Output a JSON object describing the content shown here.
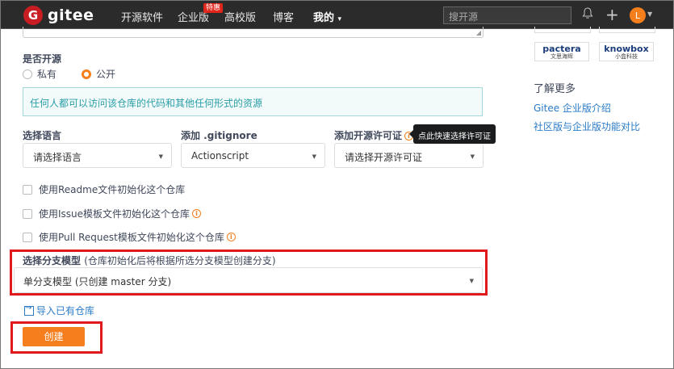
{
  "nav": {
    "brand": "gitee",
    "brand_initial": "G",
    "items": [
      "开源软件",
      "企业版",
      "高校版",
      "博客"
    ],
    "hot_badge": "特惠",
    "my": "我的",
    "my_caret": "▾",
    "search_placeholder": "搜开源",
    "avatar_initial": "L",
    "plus": "+",
    "bell": "🔔"
  },
  "form": {
    "open_source_label": "是否开源",
    "private_label": "私有",
    "public_label": "公开",
    "public_info": "任何人都可以访问该仓库的代码和其他任何形式的资源",
    "language_label": "选择语言",
    "language_value": "请选择语言",
    "gitignore_label": "添加 .gitignore",
    "gitignore_value": "Actionscript",
    "license_label": "添加开源许可证",
    "license_value": "请选择开源许可证",
    "license_tooltip": "点此快速选择许可证",
    "checks": [
      "使用Readme文件初始化这个仓库",
      "使用Issue模板文件初始化这个仓库",
      "使用Pull Request模板文件初始化这个仓库"
    ],
    "branch_label": "选择分支模型",
    "branch_hint": "(仓库初始化后将根据所选分支模型创建分支)",
    "branch_value": "单分支模型 (只创建 master 分支)",
    "import_link": "导入已有仓库",
    "create_button": "创建",
    "caret": "▼",
    "info_icon": "i"
  },
  "sidebar": {
    "logos": [
      {
        "name": "pactera",
        "sub": "文思海辉"
      },
      {
        "name": "knowbox",
        "sub": "小盒科技"
      }
    ],
    "learn_more": "了解更多",
    "links": [
      "Gitee 企业版介绍",
      "社区版与企业版功能对比"
    ]
  },
  "colors": {
    "accent": "#f57e1d",
    "nav_bg": "#2b2b2b",
    "link": "#2a7bc7",
    "highlight": "#e0191c"
  }
}
